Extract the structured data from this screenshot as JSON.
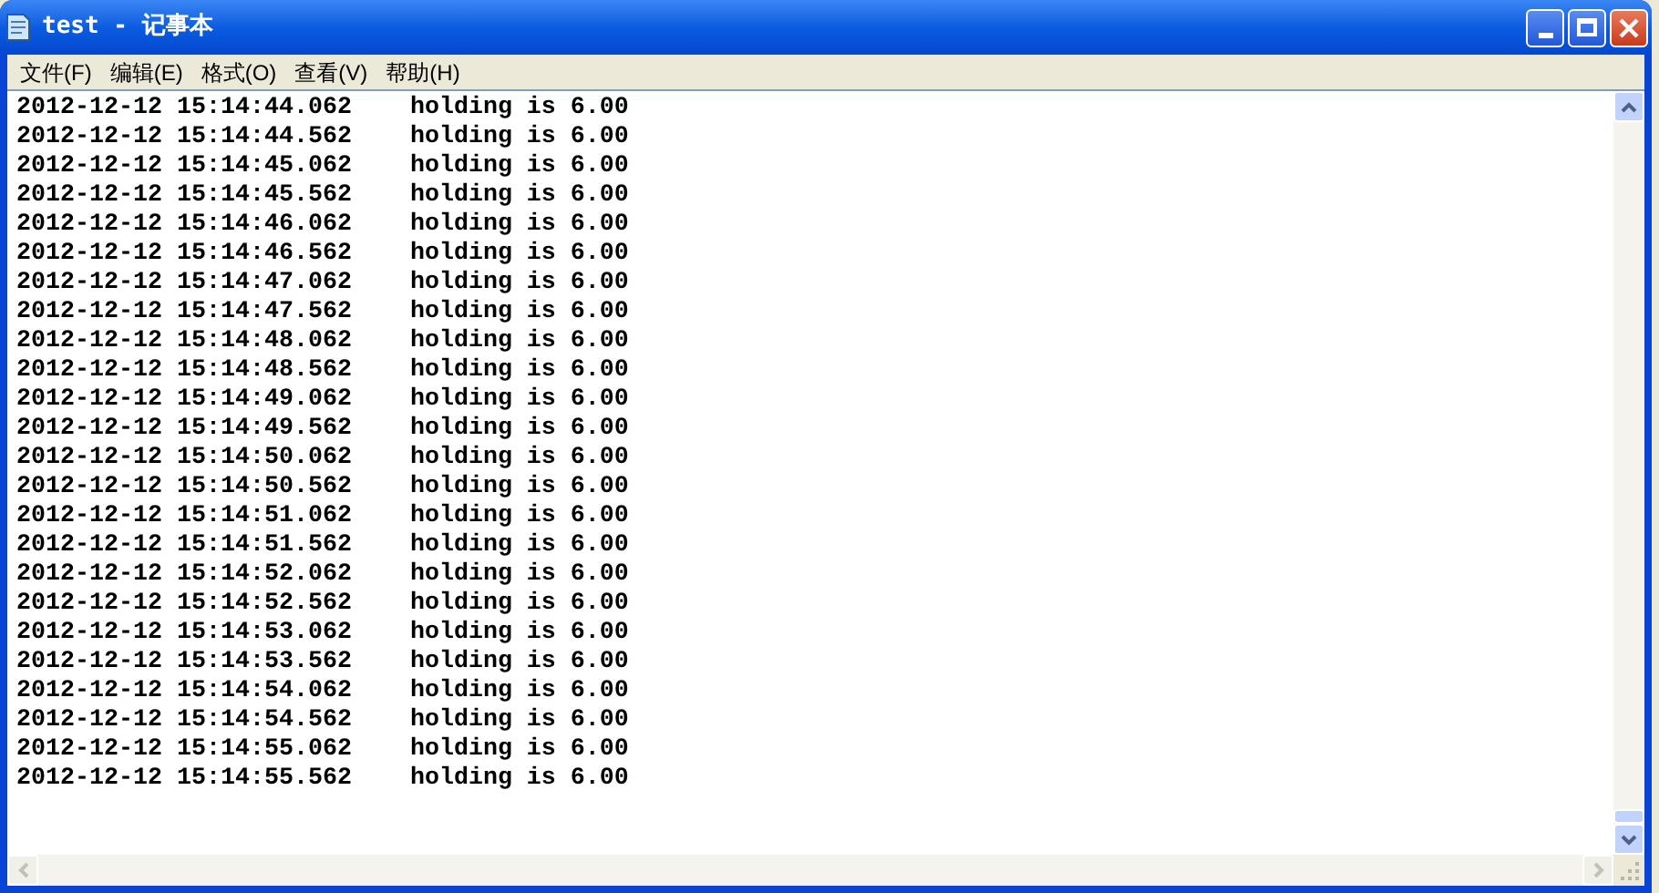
{
  "window": {
    "title": "test - 记事本"
  },
  "menu": [
    "文件(F)",
    "编辑(E)",
    "格式(O)",
    "查看(V)",
    "帮助(H)"
  ],
  "lines": [
    "2012-12-12 15:14:44.062    holding is 6.00",
    "2012-12-12 15:14:44.562    holding is 6.00",
    "2012-12-12 15:14:45.062    holding is 6.00",
    "2012-12-12 15:14:45.562    holding is 6.00",
    "2012-12-12 15:14:46.062    holding is 6.00",
    "2012-12-12 15:14:46.562    holding is 6.00",
    "2012-12-12 15:14:47.062    holding is 6.00",
    "2012-12-12 15:14:47.562    holding is 6.00",
    "2012-12-12 15:14:48.062    holding is 6.00",
    "2012-12-12 15:14:48.562    holding is 6.00",
    "2012-12-12 15:14:49.062    holding is 6.00",
    "2012-12-12 15:14:49.562    holding is 6.00",
    "2012-12-12 15:14:50.062    holding is 6.00",
    "2012-12-12 15:14:50.562    holding is 6.00",
    "2012-12-12 15:14:51.062    holding is 6.00",
    "2012-12-12 15:14:51.562    holding is 6.00",
    "2012-12-12 15:14:52.062    holding is 6.00",
    "2012-12-12 15:14:52.562    holding is 6.00",
    "2012-12-12 15:14:53.062    holding is 6.00",
    "2012-12-12 15:14:53.562    holding is 6.00",
    "2012-12-12 15:14:54.062    holding is 6.00",
    "2012-12-12 15:14:54.562    holding is 6.00",
    "2012-12-12 15:14:55.062    holding is 6.00",
    "2012-12-12 15:14:55.562    holding is 6.00"
  ]
}
